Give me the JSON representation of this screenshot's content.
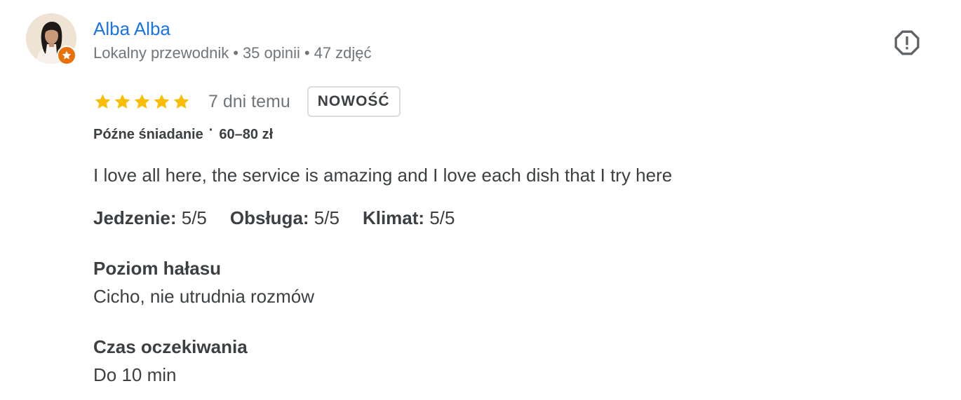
{
  "reviewer": {
    "name": "Alba Alba",
    "level": "Lokalny przewodnik",
    "separator": "•",
    "reviews_count": "35 opinii",
    "photos_count": "47 zdjęć",
    "badge_icon": "local-guide-star-icon",
    "badge_color": "#e8710a",
    "name_color": "#1a73e8"
  },
  "actions": {
    "report_icon": "report-icon"
  },
  "review": {
    "rating": 5,
    "max_rating": 5,
    "star_color": "#fbbc04",
    "date": "7 dni temu",
    "new_badge": "NOWOŚĆ",
    "meal_type": "Późne śniadanie",
    "meal_separator": "·",
    "price_range": "60–80 zł",
    "text": "I love all here, the service is amazing and I love each dish that I try here",
    "subratings": [
      {
        "label": "Jedzenie:",
        "value": "5/5"
      },
      {
        "label": "Obsługa:",
        "value": "5/5"
      },
      {
        "label": "Klimat:",
        "value": "5/5"
      }
    ],
    "attributes": [
      {
        "label": "Poziom hałasu",
        "value": "Cicho, nie utrudnia rozmów"
      },
      {
        "label": "Czas oczekiwania",
        "value": "Do 10 min"
      }
    ]
  }
}
